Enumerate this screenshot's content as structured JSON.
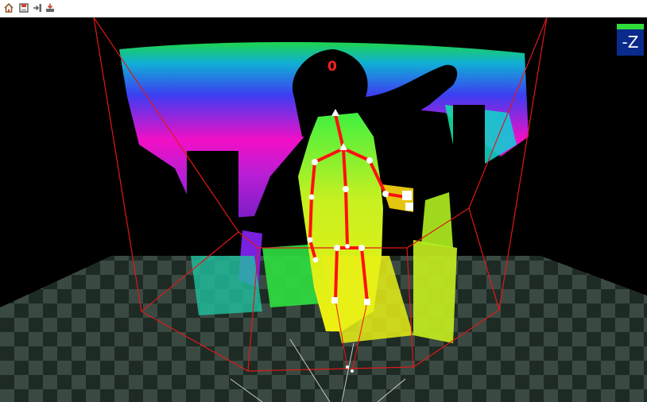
{
  "toolbar": {
    "buttons": [
      {
        "icon": "home-icon"
      },
      {
        "icon": "save-view-icon"
      },
      {
        "icon": "load-view-icon"
      },
      {
        "icon": "export-icon"
      }
    ]
  },
  "view_cube": {
    "label": "-Z",
    "top_color": "#2fdc3a",
    "face_color": "#0a2a8c"
  },
  "tracked_user": {
    "id": "0"
  },
  "colors": {
    "bounding_box": "#e01818",
    "skeleton_bone": "#ff1010",
    "skeleton_joint": "#ffffff",
    "floor_dark": "#1e2b24",
    "floor_light": "#3a4a42"
  }
}
